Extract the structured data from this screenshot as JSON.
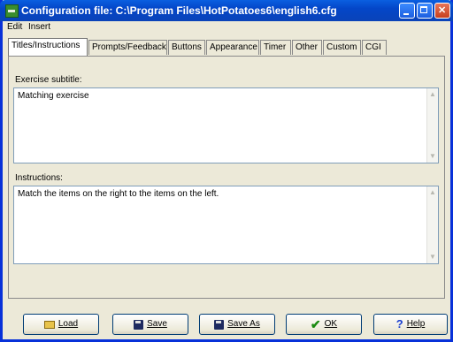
{
  "window": {
    "title": "Configuration file: C:\\Program Files\\HotPotatoes6\\english6.cfg"
  },
  "menu": [
    {
      "label": "Edit"
    },
    {
      "label": "Insert"
    }
  ],
  "tabs": [
    {
      "label": "Titles/Instructions",
      "active": true
    },
    {
      "label": "Prompts/Feedback"
    },
    {
      "label": "Buttons"
    },
    {
      "label": "Appearance"
    },
    {
      "label": "Timer"
    },
    {
      "label": "Other"
    },
    {
      "label": "Custom"
    },
    {
      "label": "CGI"
    }
  ],
  "fields": {
    "subtitle": {
      "label": "Exercise subtitle:",
      "value": "Matching exercise"
    },
    "instructions": {
      "label": "Instructions:",
      "value": "Match the items on the right to the items on the left."
    }
  },
  "buttons": {
    "load": "Load",
    "save": "Save",
    "save_as": "Save As",
    "ok": "OK",
    "help": "Help"
  },
  "icons": {
    "app": "hotpotatoes-icon",
    "load": "folder-icon",
    "save": "floppy-disk-icon",
    "save_as": "floppy-disk-icon",
    "ok": "checkmark-icon",
    "help": "question-mark-icon"
  },
  "colors": {
    "titlebar": "#0a5fe0",
    "window_bg": "#ece9d8",
    "ok_check": "#1a8a10",
    "help_icon": "#1a3fd0"
  }
}
